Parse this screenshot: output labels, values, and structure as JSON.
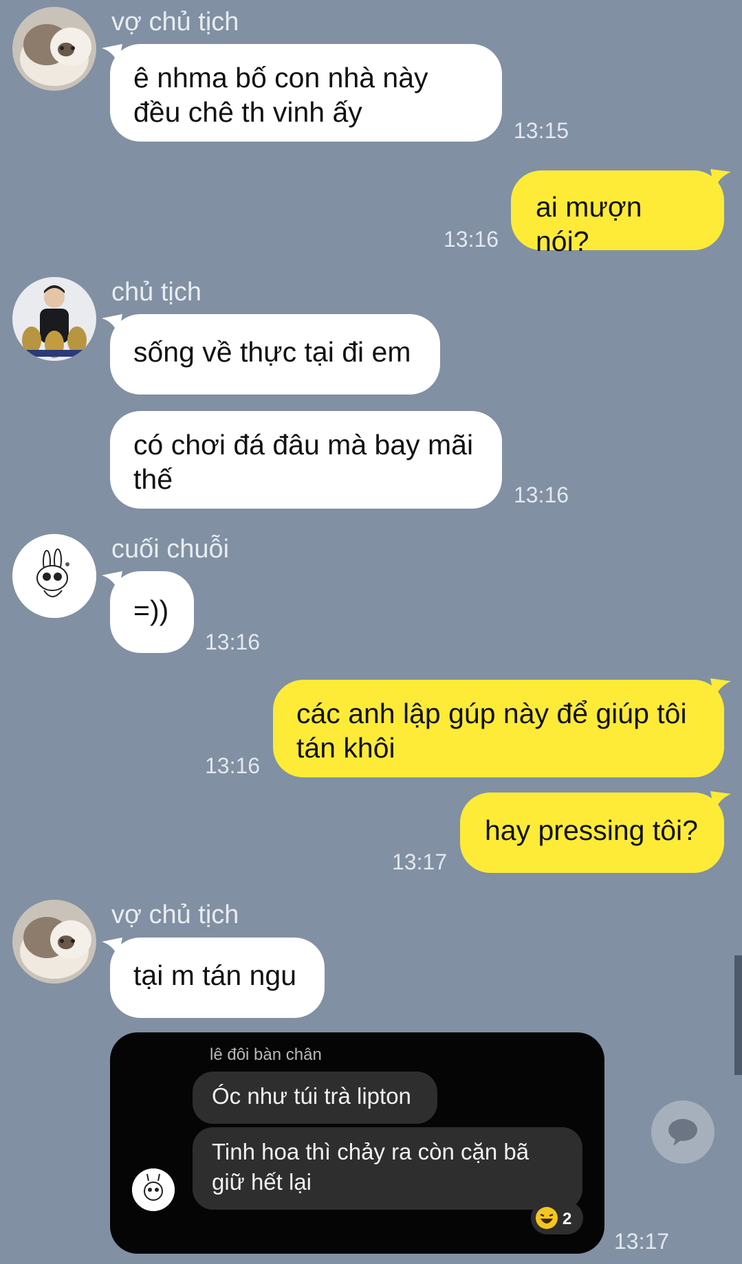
{
  "messages": [
    {
      "sender": "vợ chủ tịch",
      "lines": [
        "ê nhma bố con nhà này",
        "đều chê th vinh ấy"
      ],
      "time": "13:15"
    },
    {
      "lines": [
        "ai mượn nói?"
      ],
      "time": "13:16"
    },
    {
      "sender": "chủ tịch",
      "lines": [
        "sống về thực tại đi em"
      ]
    },
    {
      "lines": [
        "có chơi đá đâu mà bay mãi",
        "thế"
      ],
      "time": "13:16"
    },
    {
      "sender": "cuối chuỗi",
      "lines": [
        "=))"
      ],
      "time": "13:16"
    },
    {
      "lines": [
        "các anh lập gúp này để giúp tôi",
        "tán khôi"
      ],
      "time": "13:16"
    },
    {
      "lines": [
        "hay pressing tôi?"
      ],
      "time": "13:17"
    },
    {
      "sender": "vợ chủ tịch",
      "lines": [
        "tại m tán ngu"
      ]
    },
    {
      "forwarded": {
        "name": "lê đôi bàn chân",
        "bubbles": [
          {
            "lines": [
              "Óc như túi trà lipton"
            ]
          },
          {
            "lines": [
              "Tinh hoa thì chảy ra còn cặn bã",
              "giữ hết lại"
            ]
          }
        ],
        "reaction": {
          "icon": "laughing-face-icon",
          "count": "2"
        }
      },
      "time": "13:17"
    }
  ],
  "colors": {
    "background": "#8190a3",
    "incoming_bubble": "#ffffff",
    "outgoing_bubble": "#fdeb37"
  }
}
